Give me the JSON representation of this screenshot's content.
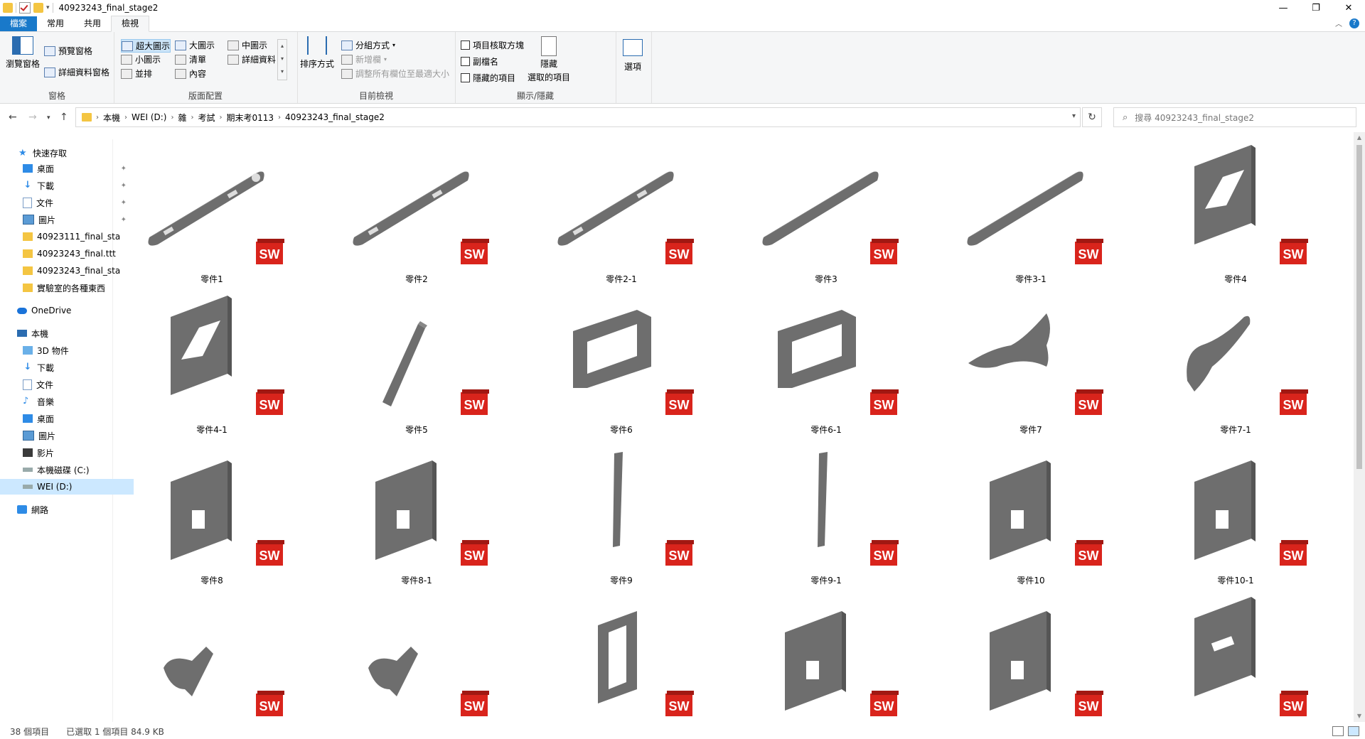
{
  "window": {
    "title": "40923243_final_stage2"
  },
  "tabs": [
    "檔案",
    "常用",
    "共用",
    "檢視"
  ],
  "ribbon": {
    "panes": {
      "label": "窗格",
      "nav_pane": "瀏覽窗格",
      "preview_pane": "預覽窗格",
      "details_pane": "詳細資料窗格"
    },
    "layout": {
      "label": "版面配置",
      "items": [
        "超大圖示",
        "大圖示",
        "中圖示",
        "小圖示",
        "清單",
        "詳細資料",
        "並排",
        "內容"
      ]
    },
    "current_view": {
      "label": "目前檢視",
      "sort": "排序方式",
      "group_by": "分組方式",
      "add_columns": "新增欄",
      "fit_columns": "調整所有欄位至最適大小"
    },
    "show_hide": {
      "label": "顯示/隱藏",
      "item_checkboxes": "項目核取方塊",
      "file_ext": "副檔名",
      "hidden_items": "隱藏的項目",
      "hide_selected_1": "隱藏",
      "hide_selected_2": "選取的項目"
    },
    "options": "選項"
  },
  "address": {
    "segments": [
      "本機",
      "WEI (D:)",
      "雜",
      "考試",
      "期末考0113",
      "40923243_final_stage2"
    ]
  },
  "search": {
    "placeholder": "搜尋 40923243_final_stage2"
  },
  "sidebar": {
    "quick_access": "快速存取",
    "quick_items": [
      "桌面",
      "下載",
      "文件",
      "圖片",
      "40923111_final_sta",
      "40923243_final.ttt",
      "40923243_final_sta",
      "實驗室的各種東西"
    ],
    "onedrive": "OneDrive",
    "this_pc": "本機",
    "pc_items": [
      "3D 物件",
      "下載",
      "文件",
      "音樂",
      "桌面",
      "圖片",
      "影片",
      "本機磁碟 (C:)",
      "WEI (D:)"
    ],
    "network": "網路"
  },
  "files": [
    "零件1",
    "零件2",
    "零件2-1",
    "零件3",
    "零件3-1",
    "零件4",
    "零件4-1",
    "零件5",
    "零件6",
    "零件6-1",
    "零件7",
    "零件7-1",
    "零件8",
    "零件8-1",
    "零件9",
    "零件9-1",
    "零件10",
    "零件10-1",
    "",
    "",
    "",
    "",
    "",
    ""
  ],
  "status": {
    "count": "38 個項目",
    "selected": "已選取 1 個項目  84.9 KB"
  },
  "colors": {
    "accent": "#1979ca",
    "part_gray": "#6e6e6e",
    "sw_red": "#d9241c"
  }
}
